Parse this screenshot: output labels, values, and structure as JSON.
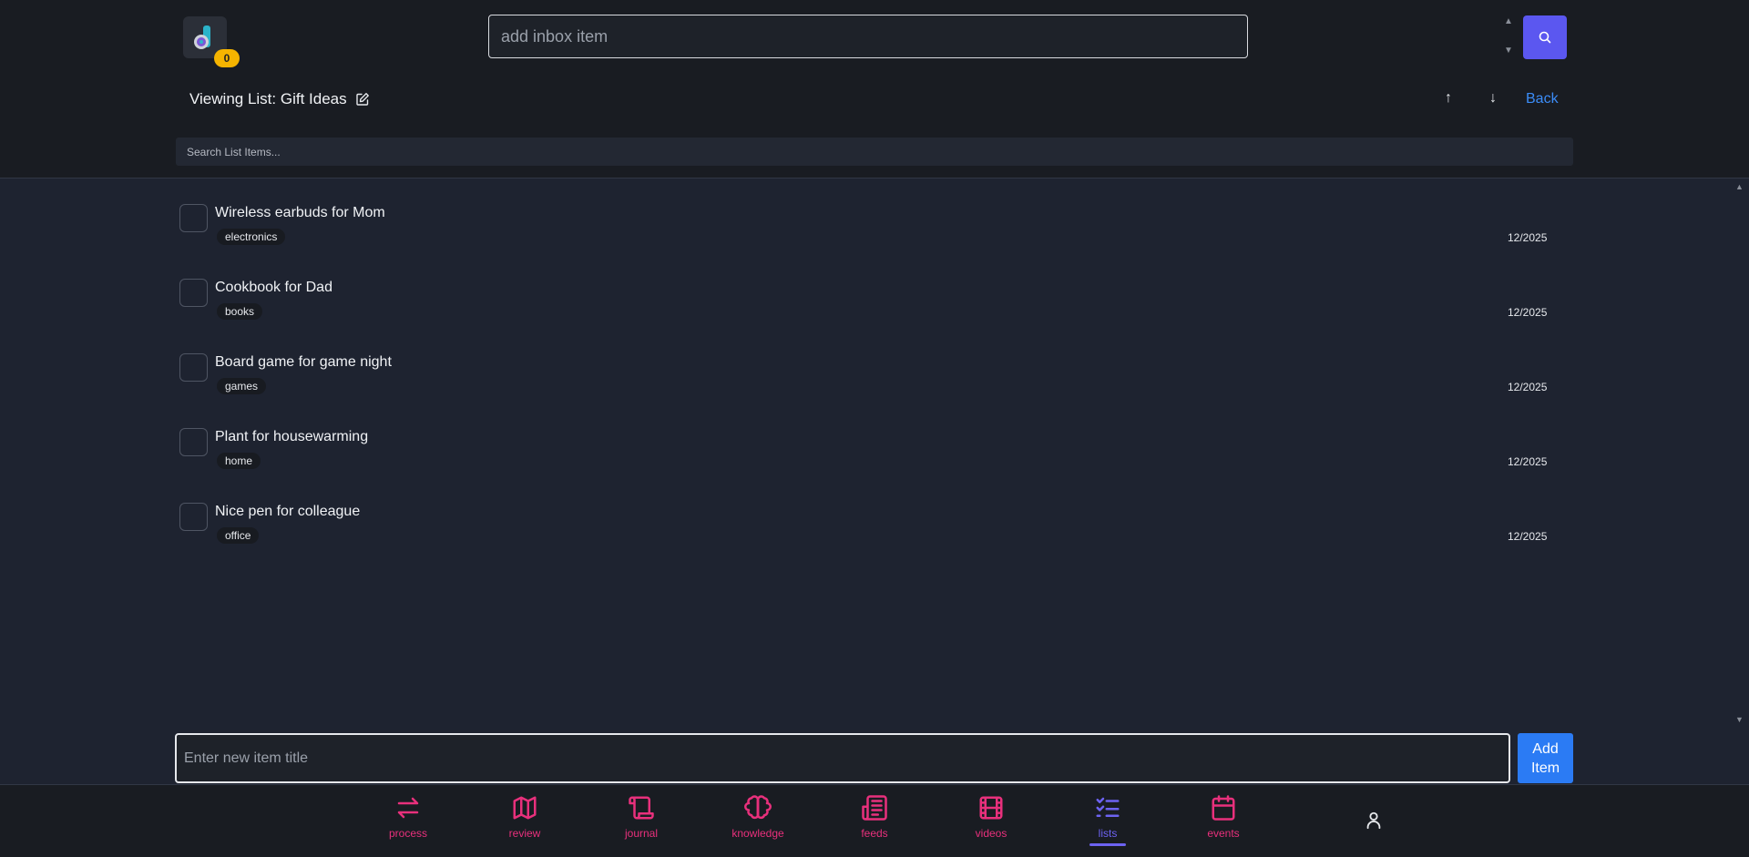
{
  "topbar": {
    "badge_count": "0",
    "inbox_placeholder": "add inbox item"
  },
  "header": {
    "title": "Viewing List: Gift Ideas",
    "up_arrow": "↑",
    "down_arrow": "↓",
    "back_label": "Back",
    "search_placeholder": "Search List Items..."
  },
  "items": [
    {
      "title": "Wireless earbuds for Mom",
      "tag": "electronics",
      "date": "12/2025"
    },
    {
      "title": "Cookbook for Dad",
      "tag": "books",
      "date": "12/2025"
    },
    {
      "title": "Board game for game night",
      "tag": "games",
      "date": "12/2025"
    },
    {
      "title": "Plant for housewarming",
      "tag": "home",
      "date": "12/2025"
    },
    {
      "title": "Nice pen for colleague",
      "tag": "office",
      "date": "12/2025"
    }
  ],
  "add_bar": {
    "placeholder": "Enter new item title",
    "button_label": "Add Item"
  },
  "nav": [
    {
      "label": "process",
      "icon": "arrows-exchange-icon"
    },
    {
      "label": "review",
      "icon": "map-icon"
    },
    {
      "label": "journal",
      "icon": "scroll-icon"
    },
    {
      "label": "knowledge",
      "icon": "brain-icon"
    },
    {
      "label": "feeds",
      "icon": "newspaper-icon"
    },
    {
      "label": "videos",
      "icon": "film-icon"
    },
    {
      "label": "lists",
      "icon": "checklist-icon",
      "active": true
    },
    {
      "label": "events",
      "icon": "calendar-icon"
    }
  ],
  "colors": {
    "accent_nav": "#e8307c",
    "active_nav": "#6d63f2",
    "primary_button": "#2b7bf4",
    "search_button": "#5b57f0",
    "badge": "#f5b400"
  }
}
